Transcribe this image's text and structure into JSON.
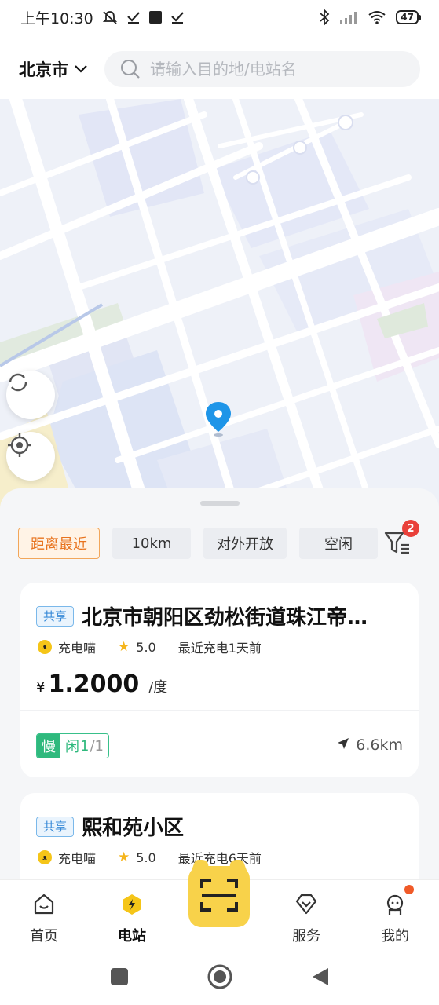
{
  "status_bar": {
    "time": "上午10:30",
    "battery": "47"
  },
  "header": {
    "city": "北京市",
    "search_placeholder": "请输入目的地/电站名"
  },
  "filters": {
    "chips": [
      {
        "label": "距离最近",
        "active": true
      },
      {
        "label": "10km",
        "active": false
      },
      {
        "label": "对外开放",
        "active": false
      },
      {
        "label": "空闲",
        "active": false
      }
    ],
    "badge_count": "2"
  },
  "stations": [
    {
      "tag": "共享",
      "name": "北京市朝阳区劲松街道珠江帝…",
      "operator": "充电喵",
      "rating": "5.0",
      "last_charge": "最近充电1天前",
      "price_symbol": "¥",
      "price": "1.2000",
      "price_unit": "/度",
      "charger_type": "慢",
      "idle_label": "闲",
      "idle_available": "1",
      "idle_total": "/1",
      "distance": "6.6km"
    },
    {
      "tag": "共享",
      "name": "熙和苑小区",
      "operator": "充电喵",
      "rating": "5.0",
      "last_charge": "最近充电6天前"
    }
  ],
  "bottom_nav": {
    "items": [
      {
        "label": "首页",
        "icon": "home-icon"
      },
      {
        "label": "电站",
        "icon": "station-icon",
        "active": true
      },
      {
        "label": "",
        "icon": "scan-icon"
      },
      {
        "label": "服务",
        "icon": "service-icon"
      },
      {
        "label": "我的",
        "icon": "profile-icon"
      }
    ]
  },
  "colors": {
    "accent_orange": "#e8731e",
    "tag_blue": "#3a8bd8",
    "slow_green": "#2fb97d",
    "scan_yellow": "#f8d24a",
    "badge_red": "#e9403a",
    "map_pin": "#1e95e8"
  }
}
